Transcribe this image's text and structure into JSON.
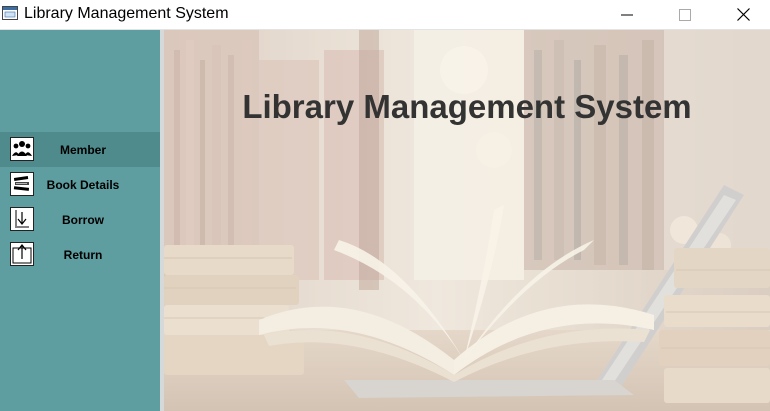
{
  "window": {
    "title": "Library Management System",
    "controls": [
      "minimize",
      "maximize",
      "close"
    ]
  },
  "sidebar": {
    "background_color": "#5f9ea0",
    "items": [
      {
        "label": "Member",
        "icon": "members-icon",
        "active": true
      },
      {
        "label": "Book Details",
        "icon": "books-icon",
        "active": false
      },
      {
        "label": "Borrow",
        "icon": "borrow-icon",
        "active": false
      },
      {
        "label": "Return",
        "icon": "return-icon",
        "active": false
      }
    ]
  },
  "main": {
    "heading": "Library Management System",
    "background": "library-books-laptop-image",
    "heading_color": "#333333"
  }
}
